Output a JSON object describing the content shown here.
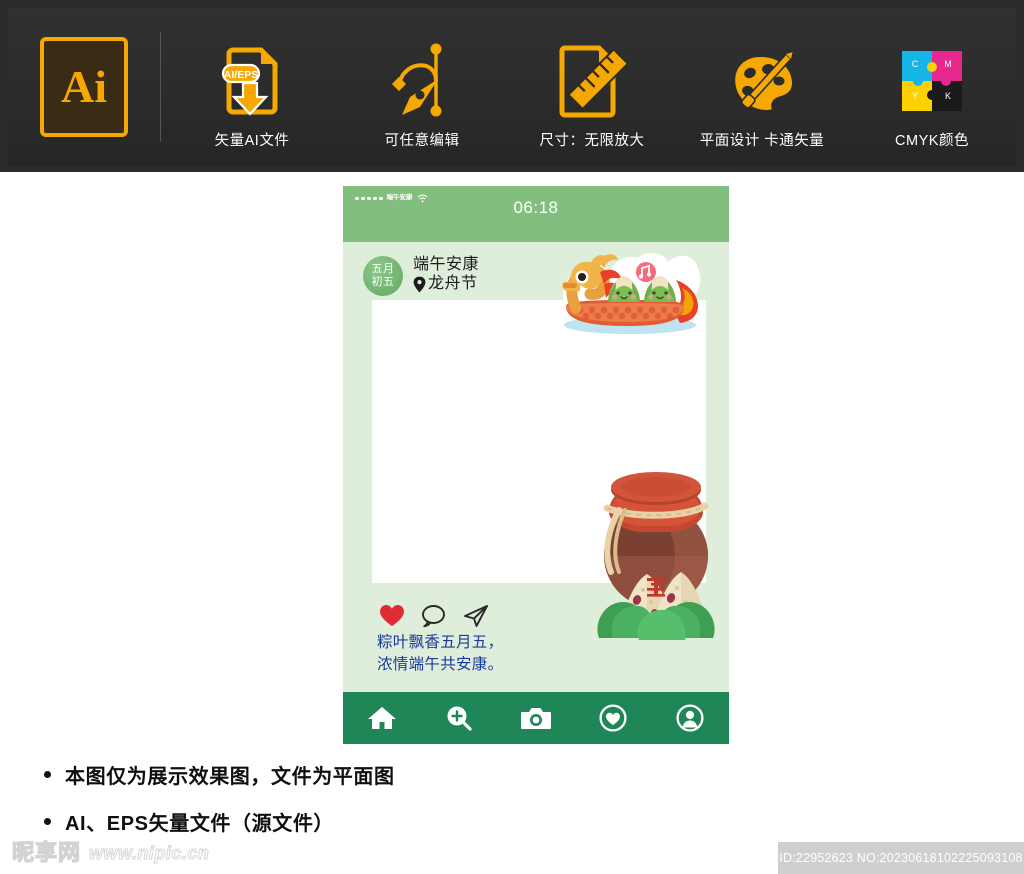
{
  "banner": {
    "logo": {
      "text": "Ai",
      "name": "adobe-illustrator-logo",
      "color": "#F5A800"
    },
    "features": [
      {
        "icon": "file-download-icon",
        "badge": "AI/EPS",
        "label": "矢量AI文件"
      },
      {
        "icon": "pen-tool-icon",
        "label": "可任意编辑"
      },
      {
        "icon": "ruler-document-icon",
        "label": "尺寸：无限放大"
      },
      {
        "icon": "palette-brush-icon",
        "label": "平面设计  卡通矢量"
      },
      {
        "icon": "cmyk-puzzle-icon",
        "label": "CMYK颜色",
        "letters": [
          "C",
          "M",
          "Y",
          "K"
        ]
      }
    ]
  },
  "phone": {
    "status_bar": {
      "carrier": "端午安康",
      "signal_dots": 5,
      "wifi": "wifi-icon",
      "time": "06:18"
    },
    "post": {
      "date_badge": {
        "line1": "五月",
        "line2": "初五"
      },
      "title": "端午安康",
      "location_icon": "location-pin-icon",
      "location": "龙舟节",
      "illustrations": [
        "dragon-boat-with-zongzi",
        "wine-jar-with-zongzi"
      ],
      "actions": [
        {
          "name": "like-icon",
          "state": "filled",
          "color": "#E02B35"
        },
        {
          "name": "comment-icon",
          "state": "outline"
        },
        {
          "name": "share-icon",
          "state": "outline"
        }
      ],
      "caption_line1": "粽叶飘香五月五，",
      "caption_line2": "浓情端午共安康。",
      "caption_color": "#1b3a9e"
    },
    "tabbar": {
      "background": "#1F8757",
      "items": [
        {
          "name": "tab-home",
          "icon": "home-icon"
        },
        {
          "name": "tab-discover",
          "icon": "search-plus-icon"
        },
        {
          "name": "tab-camera",
          "icon": "camera-icon"
        },
        {
          "name": "tab-likes",
          "icon": "heart-circle-icon"
        },
        {
          "name": "tab-profile",
          "icon": "user-circle-icon"
        }
      ]
    },
    "colors": {
      "header": "#82BE7E",
      "body": "#DFEDDB",
      "card": "#FFFFFF"
    }
  },
  "notes": [
    "本图仅为展示效果图，文件为平面图",
    "AI、EPS矢量文件（源文件）"
  ],
  "footer": {
    "watermark_logo": "昵享网",
    "watermark_url": "www.nipic.cn",
    "id_text": "ID:22952623 NO:20230618102225093108"
  }
}
